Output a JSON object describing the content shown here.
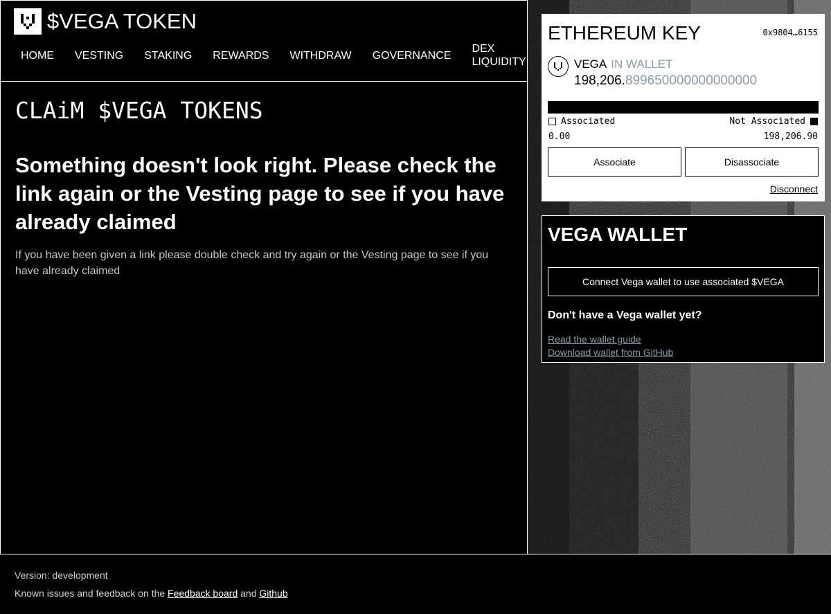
{
  "brand": {
    "title": "$VEGA TOKEN",
    "logo_icon": "vega-logo-icon"
  },
  "nav": {
    "items": [
      {
        "label": "HOME"
      },
      {
        "label": "VESTING"
      },
      {
        "label": "STAKING"
      },
      {
        "label": "REWARDS"
      },
      {
        "label": "WITHDRAW"
      },
      {
        "label": "GOVERNANCE"
      },
      {
        "label": "DEX LIQUIDITY"
      }
    ]
  },
  "main": {
    "title": "CLAiM $VEGA TOKENS",
    "error_heading": "Something doesn't look right. Please check the link again or the Vesting page to see if you have already claimed",
    "error_sub": "If you have been given a link please double check and try again or the Vesting page to see if you have already claimed"
  },
  "ethereum": {
    "title": "ETHEREUM KEY",
    "address": "0x9804…6155",
    "token_label": "VEGA",
    "wallet_label": "IN WALLET",
    "amount_int": "198,206.",
    "amount_dec": "899650000000000000",
    "associated_label": "Associated",
    "not_associated_label": "Not Associated",
    "associated_value": "0.00",
    "not_associated_value": "198,206.90",
    "associate_button": "Associate",
    "disassociate_button": "Disassociate",
    "disconnect_link": "Disconnect"
  },
  "vega_wallet": {
    "title": "VEGA WALLET",
    "connect_button": "Connect Vega wallet to use associated $VEGA",
    "no_wallet_heading": "Don't have a Vega wallet yet?",
    "guide_link": "Read the wallet guide",
    "download_link": "Download wallet from GitHub"
  },
  "footer": {
    "version": "Version: development",
    "issues_prefix": "Known issues and feedback on the",
    "feedback_link": "Feedback board",
    "and_text": "and",
    "github_link": "Github"
  },
  "colors": {
    "background": "#000000",
    "accent_grey": "#8a9ba8",
    "card": "#ffffff"
  }
}
